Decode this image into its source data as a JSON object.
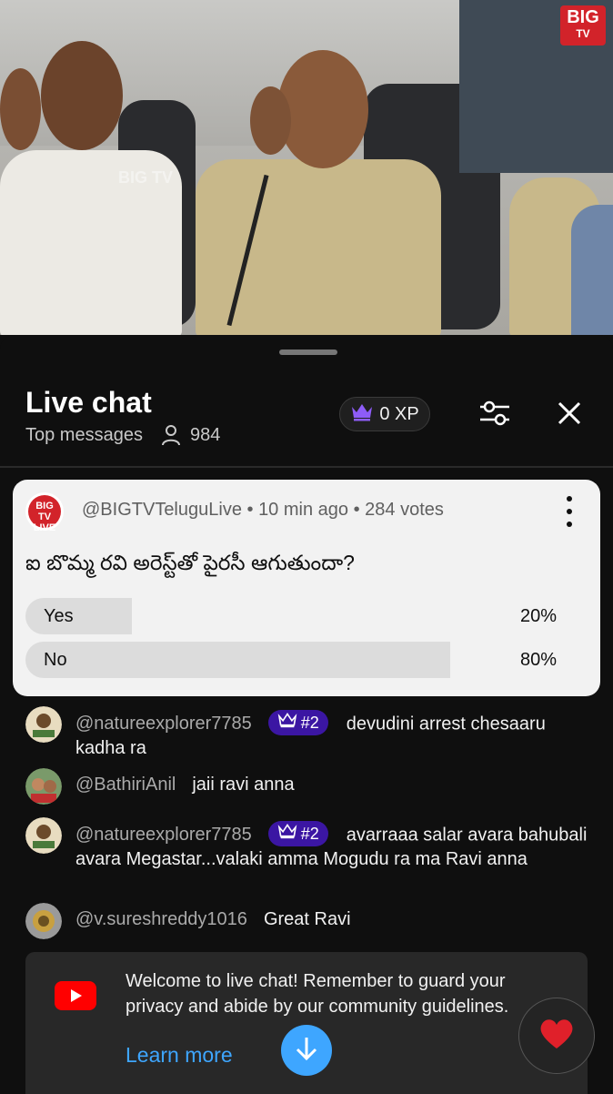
{
  "video": {
    "logo_line1": "BIG",
    "logo_line2": "TV",
    "watermark": "BIG TV"
  },
  "chat": {
    "title": "Live chat",
    "mode": "Top messages",
    "viewer_count": "984",
    "xp_label": "0 XP",
    "icons": {
      "viewers": "person-icon",
      "xp": "crown-icon",
      "filter": "sliders-icon",
      "close": "close-icon"
    }
  },
  "poll": {
    "author": "@BIGTVTeluguLive",
    "time": "10 min ago",
    "votes": "284 votes",
    "avatar_text": "BIG TV LIVE",
    "question": "ఐ బొమ్మ రవి అరెస్ట్‌తో పైరసీ ఆగుతుందా?",
    "options": [
      {
        "label": "Yes",
        "percent_text": "20%",
        "fraction": 0.2
      },
      {
        "label": "No",
        "percent_text": "80%",
        "fraction": 0.8
      }
    ]
  },
  "messages": [
    {
      "author": "@natureexplorer7785",
      "badge": "#2",
      "text": "devudini arrest chesaaru kadha ra"
    },
    {
      "author": "@BathiriAnil",
      "badge": null,
      "text": "jaii ravi anna"
    },
    {
      "author": "@natureexplorer7785",
      "badge": "#2",
      "text": "avarraaa salar avara bahubali avara Megastar...valaki amma Mogudu ra ma Ravi anna"
    },
    {
      "author": "@v.sureshreddy1016",
      "badge": null,
      "text": "Great Ravi"
    }
  ],
  "welcome": {
    "text": "Welcome to live chat! Remember to guard your privacy and abide by our community guidelines.",
    "learn_more": "Learn more"
  },
  "colors": {
    "accent": "#3ea6ff",
    "badge": "#3b16a3",
    "youtube_red": "#ff0000",
    "brand_red": "#d2232a"
  }
}
